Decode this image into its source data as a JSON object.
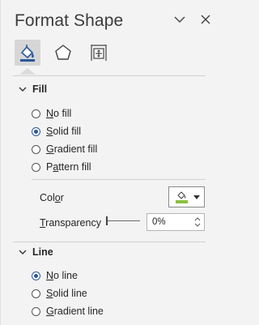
{
  "pane": {
    "title": "Format Shape",
    "options_icon": "chevron-down-icon",
    "close_icon": "close-icon"
  },
  "tabs": [
    {
      "name": "fill-line-tab",
      "icon": "paint-bucket-icon",
      "active": true
    },
    {
      "name": "effects-tab",
      "icon": "pentagon-icon",
      "active": false
    },
    {
      "name": "size-properties-tab",
      "icon": "size-properties-icon",
      "active": false
    }
  ],
  "fill": {
    "heading": "Fill",
    "options": [
      {
        "label_u": "N",
        "label_rest": "o fill",
        "checked": false
      },
      {
        "label_u": "S",
        "label_rest": "olid fill",
        "checked": true
      },
      {
        "label_u": "G",
        "label_rest": "radient fill",
        "checked": false
      },
      {
        "label_pre": "P",
        "label_u": "a",
        "label_rest": "ttern fill",
        "checked": false
      }
    ],
    "color_label_pre": "Col",
    "color_label_u": "o",
    "color_label_rest": "r",
    "color_swatch": "#8ac13f",
    "transparency_label_u": "T",
    "transparency_label_rest": "ransparency",
    "transparency_value": "0%",
    "transparency_level": 0
  },
  "line": {
    "heading": "Line",
    "options": [
      {
        "label_u": "N",
        "label_rest": "o line",
        "checked": true
      },
      {
        "label_u": "S",
        "label_rest": "olid line",
        "checked": false
      },
      {
        "label_u": "G",
        "label_rest": "radient line",
        "checked": false
      }
    ]
  },
  "colors": {
    "accent": "#2b579a",
    "background": "#f3f3f3"
  }
}
